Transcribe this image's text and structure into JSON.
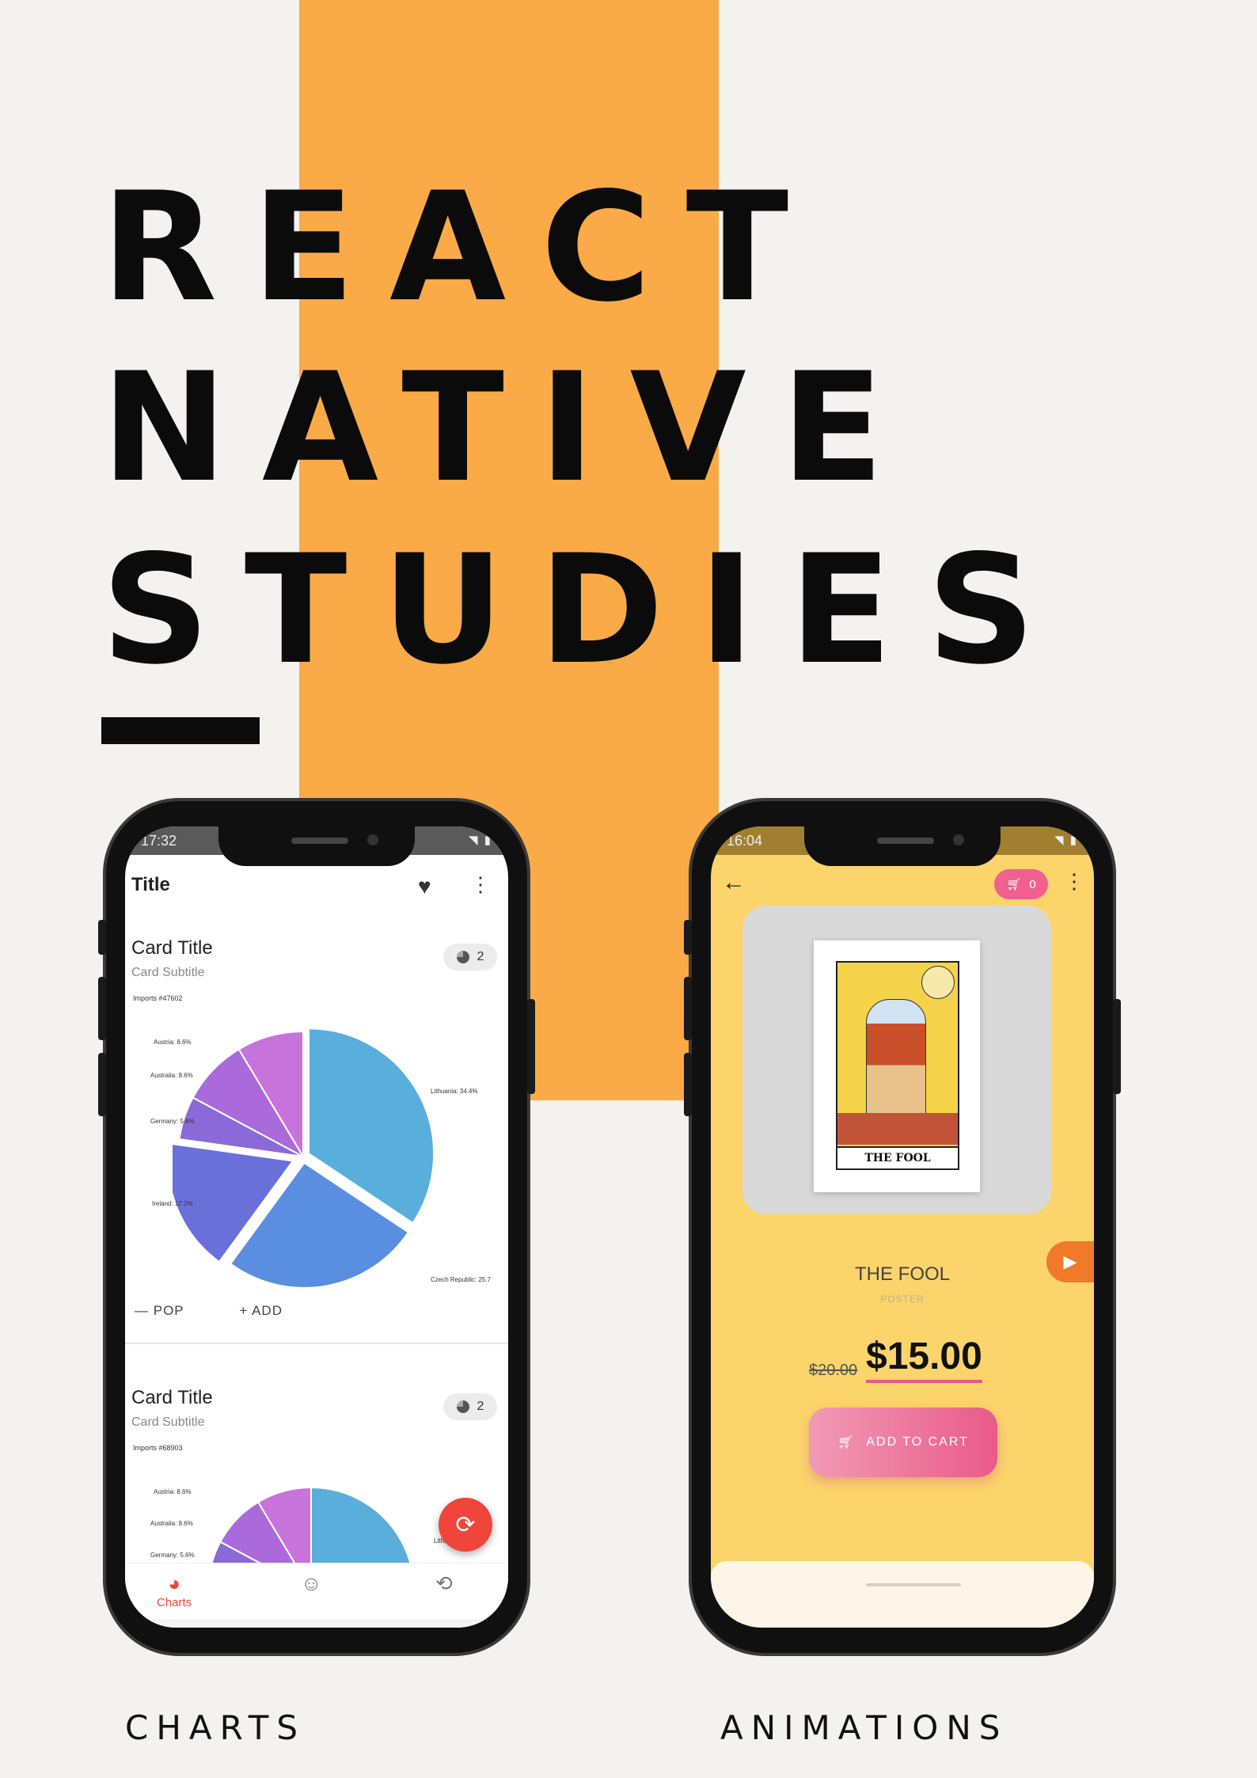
{
  "headline": {
    "line1": "REACT",
    "line2": "NATIVE",
    "line3": "STUDIES"
  },
  "captions": {
    "left": "CHARTS",
    "right": "ANIMATIONS"
  },
  "colors": {
    "stripe": "#fbaa48",
    "fab": "#f0453b",
    "accent_pink": "#ea5a8a",
    "screen_yellow": "#fcd46c"
  },
  "charts_app": {
    "status_time": "17:32",
    "title": "Title",
    "card1": {
      "title": "Card Title",
      "subtitle": "Card Subtitle",
      "imports": "Imports #47602",
      "chip_count": "2",
      "labels": [
        "Austria: 8.6%",
        "Australia: 8.6%",
        "Germany: 5.6%",
        "Ireland: 17.2%",
        "Lithuania: 34.4%",
        "Czech Republic: 25.7"
      ]
    },
    "card2": {
      "title": "Card Title",
      "subtitle": "Card Subtitle",
      "imports": "Imports #68903",
      "chip_count": "2",
      "labels": [
        "Austria: 8.6%",
        "Australia: 8.6%",
        "Germany: 5.6%",
        "Lithu"
      ]
    },
    "actions": {
      "pop": "POP",
      "add": "ADD"
    },
    "nav": {
      "charts": "Charts"
    },
    "icons": [
      "heart-icon",
      "more-vert-icon",
      "pie-chart-icon",
      "refresh-icon",
      "smiley-icon",
      "history-icon"
    ]
  },
  "animations_app": {
    "status_time": "16:04",
    "cart_count": "0",
    "card_name": "THE FOOL",
    "product_name": "THE FOOL",
    "product_type": "POSTER",
    "old_price": "$20.00",
    "price": "$15.00",
    "add_button": "ADD TO CART",
    "icons": [
      "back-arrow-icon",
      "cart-icon",
      "more-vert-icon",
      "video-camera-icon"
    ]
  },
  "chart_data": [
    {
      "type": "pie",
      "title": "Imports #47602",
      "categories": [
        "Lithuania",
        "Czech Republic",
        "Ireland",
        "Germany",
        "Australia",
        "Austria"
      ],
      "values": [
        34.4,
        25.7,
        17.2,
        5.6,
        8.6,
        8.6
      ],
      "colors": [
        "#5aaedc",
        "#5a8ee0",
        "#6a70da",
        "#8a6ad8",
        "#aa6adc",
        "#c872dc"
      ]
    }
  ]
}
